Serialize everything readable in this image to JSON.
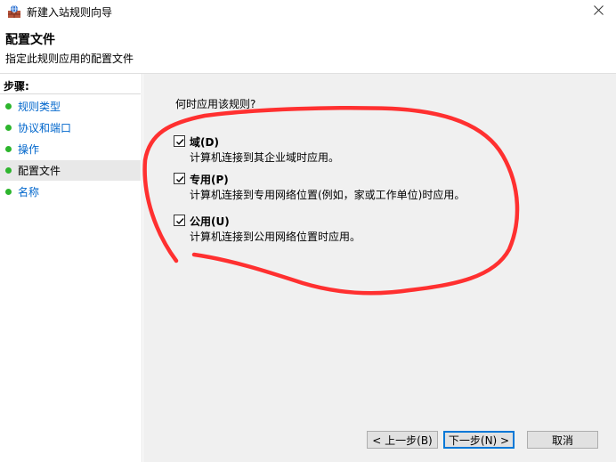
{
  "window": {
    "title": "新建入站规则向导"
  },
  "header": {
    "title": "配置文件",
    "subtitle": "指定此规则应用的配置文件"
  },
  "sidebar": {
    "steps_label": "步骤:",
    "items": [
      {
        "label": "规则类型"
      },
      {
        "label": "协议和端口"
      },
      {
        "label": "操作"
      },
      {
        "label": "配置文件"
      },
      {
        "label": "名称"
      }
    ],
    "active_index": 3
  },
  "main": {
    "question": "何时应用该规则?",
    "options": [
      {
        "title": "域(D)",
        "desc": "计算机连接到其企业域时应用。",
        "checked": true
      },
      {
        "title": "专用(P)",
        "desc": "计算机连接到专用网络位置(例如，家或工作单位)时应用。",
        "checked": true
      },
      {
        "title": "公用(U)",
        "desc": "计算机连接到公用网络位置时应用。",
        "checked": true
      }
    ]
  },
  "buttons": {
    "back": "< 上一步(B)",
    "next": "下一步(N) >",
    "cancel": "取消"
  },
  "colors": {
    "accent": "#0078d7",
    "step_dot": "#2db52d",
    "annotation": "#ff3030"
  },
  "icons": {
    "app": "firewall-wall-icon",
    "close": "close-icon",
    "check": "checkmark-icon"
  }
}
